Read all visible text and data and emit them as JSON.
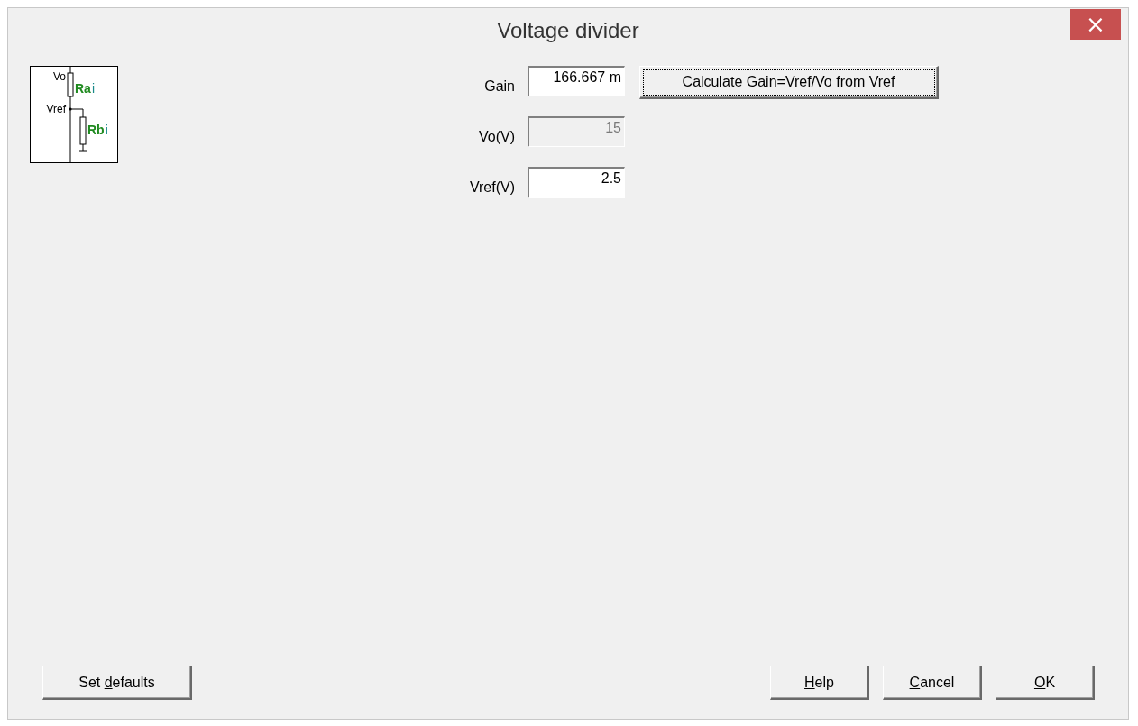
{
  "window": {
    "title": "Voltage divider",
    "close": "×"
  },
  "diagram": {
    "labels": [
      {
        "kind": "node",
        "text": "Vo"
      },
      {
        "kind": "node",
        "text": "Vref"
      },
      {
        "kind": "resistor",
        "text": "Ra",
        "suffix": "i"
      },
      {
        "kind": "resistor",
        "text": "Rb",
        "suffix": "i"
      }
    ]
  },
  "fields": [
    {
      "label": "Gain",
      "value": "166.667 m",
      "disabled": false
    },
    {
      "label": "Vo(V)",
      "value": "15",
      "disabled": true
    },
    {
      "label": "Vref(V)",
      "value": "2.5",
      "disabled": false
    }
  ],
  "calculate_button": {
    "label": "Calculate Gain=Vref/Vo from Vref",
    "focused": true
  },
  "buttons": [
    {
      "kind": "left",
      "before": "Set ",
      "access_key": "d",
      "after": "efaults"
    },
    {
      "kind": "right",
      "access_key": "H",
      "after": "elp"
    },
    {
      "kind": "right",
      "access_key": "C",
      "after": "ancel"
    },
    {
      "kind": "right",
      "access_key": "O",
      "after": "K"
    }
  ]
}
